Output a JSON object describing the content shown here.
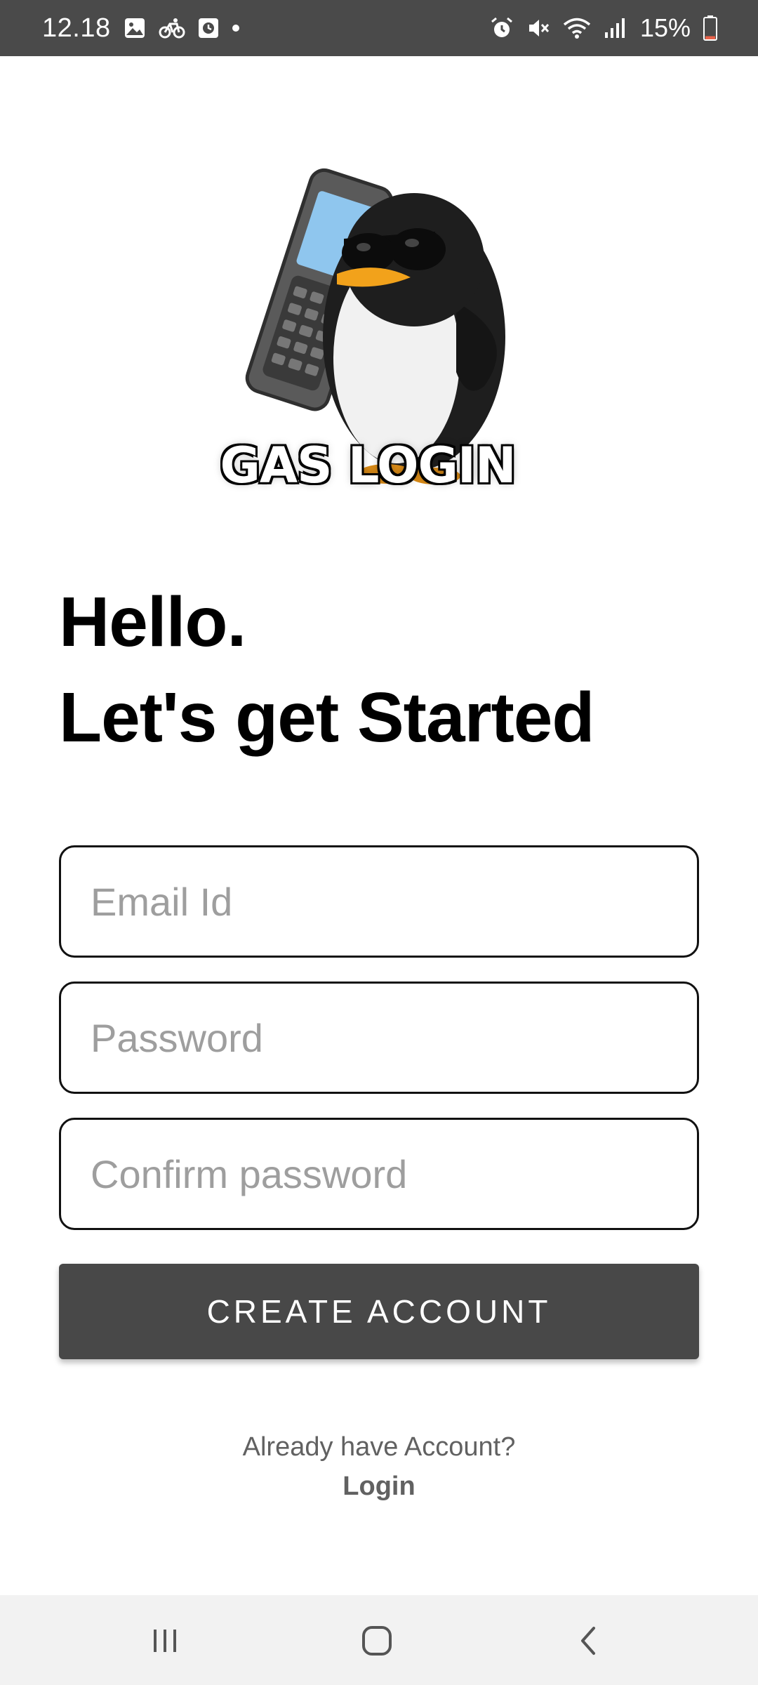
{
  "status_bar": {
    "time": "12.18",
    "battery_percent": "15%",
    "left_icons": [
      "image-icon",
      "cycling-icon",
      "clock-app-icon",
      "dot-icon"
    ],
    "right_icons": [
      "alarm-icon",
      "mute-icon",
      "wifi-icon",
      "signal-icon",
      "battery-icon"
    ],
    "battery_level": 0.15,
    "battery_color": "#e8624a"
  },
  "logo": {
    "title": "GAS LOGIN",
    "image": "penguin-with-phone"
  },
  "heading": {
    "line1": "Hello.",
    "line2": "Let's get Started"
  },
  "form": {
    "email_placeholder": "Email Id",
    "email_value": "",
    "password_placeholder": "Password",
    "password_value": "",
    "confirm_placeholder": "Confirm password",
    "confirm_value": "",
    "create_button": "CREATE ACCOUNT"
  },
  "footer": {
    "already_text": "Already have Account?",
    "login_link": "Login"
  },
  "nav_bar": {
    "buttons": [
      "recent-apps-icon",
      "home-icon",
      "back-icon"
    ]
  },
  "colors": {
    "status_bar_bg": "#4a4a4a",
    "button_bg": "#484848",
    "placeholder": "#9e9e9e",
    "footer_text": "#616161",
    "nav_bar_bg": "#f2f2f2"
  }
}
